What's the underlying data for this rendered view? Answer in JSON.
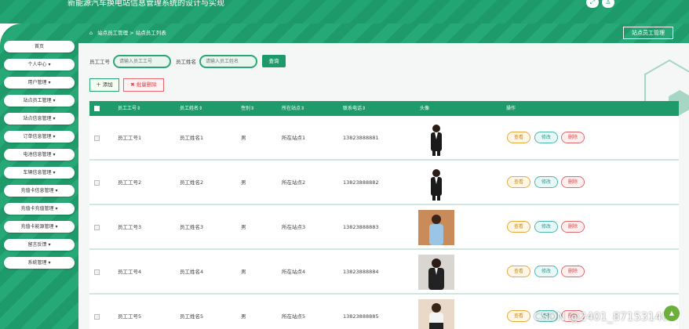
{
  "app": {
    "title": "新能源汽车换电站信息管理系统的设计与实现",
    "top_icons": [
      "expand-icon",
      "user-icon"
    ]
  },
  "sidebar": {
    "items": [
      {
        "label": "首页"
      },
      {
        "label": "个人中心 ▾"
      },
      {
        "label": "用户管理 ▾"
      },
      {
        "label": "站点员工管理 ▾"
      },
      {
        "label": "站点信息管理 ▾"
      },
      {
        "label": "订单信息管理 ▾"
      },
      {
        "label": "电池信息管理 ▾"
      },
      {
        "label": "车辆信息管理 ▾"
      },
      {
        "label": "充值卡信息管理 ▾"
      },
      {
        "label": "充值卡充值管理 ▾"
      },
      {
        "label": "充值卡能源管理 ▾"
      },
      {
        "label": "留言反馈 ▾"
      },
      {
        "label": "系统管理 ▾"
      }
    ]
  },
  "breadcrumb": {
    "part1": "站点员工管理",
    "sep": ">",
    "part2": "站点员工列表"
  },
  "page_button": "站点员工管理",
  "search": {
    "field1_label": "员工工号",
    "field1_placeholder": "请输入员工工号",
    "field2_label": "员工姓名",
    "field2_placeholder": "请输入员工姓名",
    "query_label": "查询"
  },
  "actions": {
    "add_label": "＋ 添加",
    "batch_delete_label": "✖ 批量删除"
  },
  "table": {
    "headers": {
      "id": "员工工号⇕",
      "name": "员工姓名⇕",
      "gender": "性别⇕",
      "station": "所在站点⇕",
      "phone": "联系电话⇕",
      "avatar": "头像",
      "ops": "操作"
    },
    "rows": [
      {
        "id": "员工工号1",
        "name": "员工姓名1",
        "gender": "男",
        "station": "所在站点1",
        "phone": "13823888881"
      },
      {
        "id": "员工工号2",
        "name": "员工姓名2",
        "gender": "男",
        "station": "所在站点2",
        "phone": "13823888882"
      },
      {
        "id": "员工工号3",
        "name": "员工姓名3",
        "gender": "男",
        "station": "所在站点3",
        "phone": "13823888883"
      },
      {
        "id": "员工工号4",
        "name": "员工姓名4",
        "gender": "男",
        "station": "所在站点4",
        "phone": "13823888884"
      },
      {
        "id": "员工工号5",
        "name": "员工姓名5",
        "gender": "男",
        "station": "所在站点5",
        "phone": "13823888885"
      }
    ],
    "row_actions": {
      "view": "查看",
      "edit": "修改",
      "delete": "删除"
    }
  },
  "watermark": "CSDN @2401_87153140",
  "colors": {
    "primary": "#1e9a6a",
    "danger": "#e2676c",
    "warning": "#e7a93a",
    "info": "#49b9b1"
  }
}
